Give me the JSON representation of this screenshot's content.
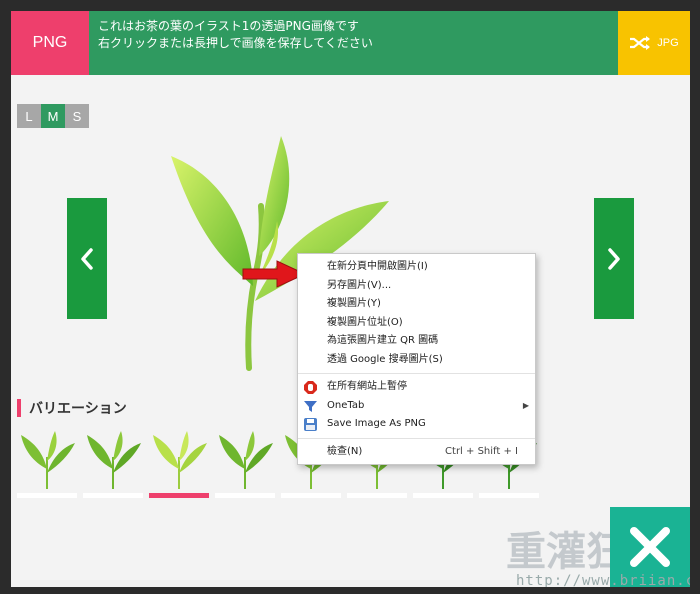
{
  "banner": {
    "png_label": "PNG",
    "message_line1": "これはお茶の葉のイラスト1の透過PNG画像です",
    "message_line2": "右クリックまたは長押しで画像を保存してください",
    "jpg_label": "JPG"
  },
  "size_selector": {
    "large": "L",
    "medium": "M",
    "small": "S",
    "active": "M"
  },
  "variations": {
    "title": "バリエーション",
    "active_index": 2,
    "thumbnail_count": 8
  },
  "context_menu": {
    "items_group1": [
      "在新分頁中開啟圖片(I)",
      "另存圖片(V)...",
      "複製圖片(Y)",
      "複製圖片位址(O)",
      "為這張圖片建立 QR 圖碼",
      "透過 Google 搜尋圖片(S)"
    ],
    "items_group2": [
      {
        "label": "在所有網站上暫停",
        "icon": "stop-sign-icon"
      },
      {
        "label": "OneTab",
        "icon": "onetab-funnel-icon",
        "submenu": true
      },
      {
        "label": "Save Image As PNG",
        "icon": "save-png-icon"
      }
    ],
    "inspect": {
      "label": "檢查(N)",
      "shortcut": "Ctrl + Shift + I"
    }
  },
  "watermark": {
    "big": "重灌狂人",
    "url": "http://www.briian.com"
  },
  "colors": {
    "png": "#ee3f6c",
    "banner": "#2f9a60",
    "jpg": "#f8c300",
    "nav": "#1a9a3e",
    "close": "#1ab394"
  }
}
